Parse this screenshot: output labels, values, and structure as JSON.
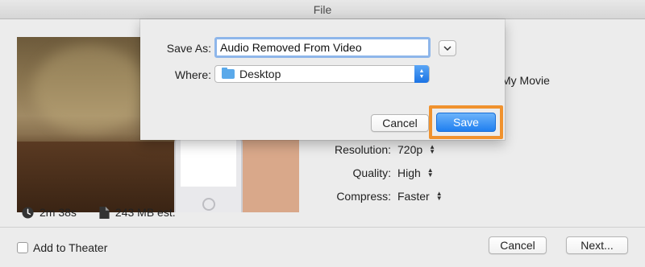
{
  "window": {
    "title": "File"
  },
  "preview": {
    "duration": "2m 38s",
    "size_estimate": "243 MB est."
  },
  "behind_sheet": {
    "title_fragment": "My Movie"
  },
  "settings": {
    "resolution": {
      "label": "Resolution:",
      "value": "720p"
    },
    "quality": {
      "label": "Quality:",
      "value": "High"
    },
    "compress": {
      "label": "Compress:",
      "value": "Faster"
    }
  },
  "footer": {
    "add_to_theater": "Add to Theater",
    "cancel": "Cancel",
    "next": "Next..."
  },
  "save_sheet": {
    "save_as_label": "Save As:",
    "filename": "Audio Removed From Video",
    "where_label": "Where:",
    "where_value": "Desktop",
    "cancel": "Cancel",
    "save": "Save"
  },
  "colors": {
    "accent": "#1f7ff0",
    "highlight": "#f0922e",
    "folder": "#5aa9ea"
  }
}
